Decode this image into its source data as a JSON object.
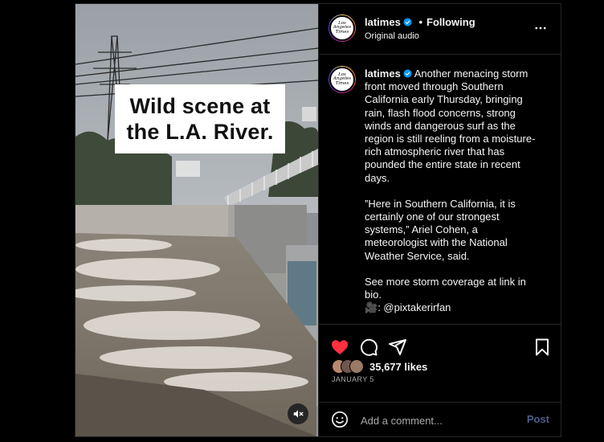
{
  "media": {
    "overlay_line1": "Wild scene at",
    "overlay_line2": "the L.A. River.",
    "mute_icon": "speaker-muted-icon"
  },
  "header": {
    "username": "latimes",
    "separator": "•",
    "follow_status": "Following",
    "audio": "Original audio",
    "more_icon": "more-horizontal-icon"
  },
  "logo": {
    "line1": "Los",
    "line2": "Angeles",
    "line3": "Times"
  },
  "caption": {
    "username": "latimes",
    "paragraph1": "Another menacing storm front moved through Southern California early Thursday, bringing rain, flash flood concerns, strong winds and dangerous surf as the region is still reeling from a moisture-rich atmospheric river that has pounded the entire state in recent days.",
    "paragraph2": "”Here in Southern California, it is certainly one of our strongest systems,” Ariel Cohen, a meteorologist with the National Weather Service, said.",
    "paragraph3": "See more storm coverage at link in bio.",
    "credit_emoji": "🎥",
    "credit": ": @pixtakerirfan"
  },
  "actions": {
    "like_icon": "heart-filled-icon",
    "comment_icon": "comment-icon",
    "share_icon": "share-icon",
    "save_icon": "bookmark-icon",
    "like_color": "#ff3040"
  },
  "likes": {
    "count_text": "35,677 likes"
  },
  "date": "JANUARY 5",
  "comment": {
    "placeholder": "Add a comment...",
    "post_label": "Post",
    "emoji_icon": "emoji-icon"
  },
  "colors": {
    "background": "#000000",
    "border": "#262626",
    "verified": "#0095f6",
    "post_disabled": "#4d5e8c"
  }
}
